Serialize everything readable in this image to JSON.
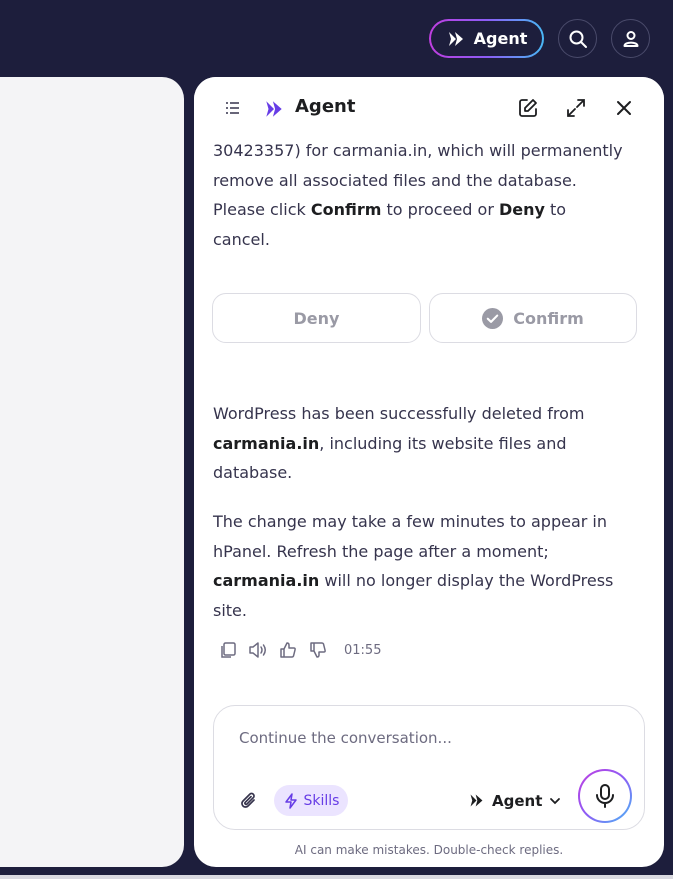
{
  "topbar": {
    "agent_label": "Agent"
  },
  "chat": {
    "header_title": "Agent",
    "messages": {
      "m1_l1": "30423357) for carmania.in, which will permanently",
      "m1_l2": "remove all associated files and the database.",
      "m1_l3_a": "Please click ",
      "m1_l3_b": "Confirm",
      "m1_l3_c": " to proceed or ",
      "m1_l3_d": "Deny",
      "m1_l3_e": " to",
      "m1_l4": "cancel.",
      "m2_a": "WordPress has been successfully deleted from",
      "m2_b": "carmania.in",
      "m2_c": ", including its website files and",
      "m2_d": "database.",
      "m3_a": "The change may take a few minutes to appear in",
      "m3_b": "hPanel. Refresh the page after a moment;",
      "m3_c": "carmania.in",
      "m3_d": " will no longer display the WordPress",
      "m3_e": "site."
    },
    "deny_label": "Deny",
    "confirm_label": "Confirm",
    "timestamp": "01:55",
    "composer": {
      "placeholder": "Continue the conversation...",
      "skills_label": "Skills",
      "agent_label": "Agent"
    },
    "disclaimer": "AI can make mistakes. Double-check replies."
  },
  "colors": {
    "background": "#1d1e3c",
    "accent": "#673de6",
    "gradient_start": "#c03ee0",
    "gradient_end": "#49b8f5"
  },
  "icons": [
    "agent-logo-icon",
    "search-icon",
    "user-icon",
    "list-icon",
    "edit-icon",
    "expand-icon",
    "close-icon",
    "check-circle-icon",
    "copy-icon",
    "speaker-icon",
    "thumbs-up-icon",
    "thumbs-down-icon",
    "paperclip-icon",
    "lightning-icon",
    "chevron-down-icon",
    "microphone-icon"
  ]
}
